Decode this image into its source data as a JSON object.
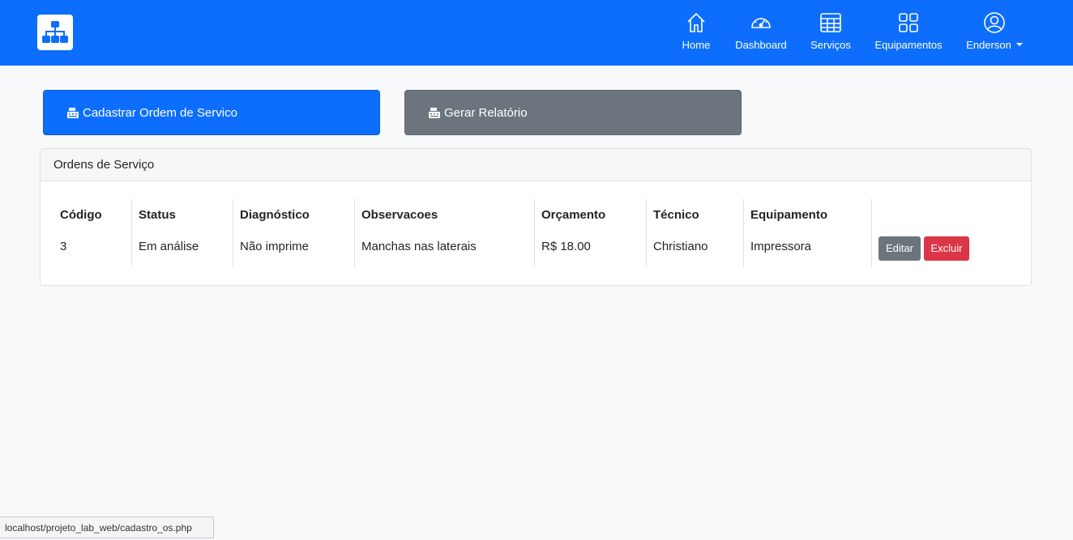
{
  "navbar": {
    "brand_icon": "sitemap-icon",
    "items": [
      {
        "label": "Home",
        "icon": "house-icon"
      },
      {
        "label": "Dashboard",
        "icon": "speedometer-icon"
      },
      {
        "label": "Serviços",
        "icon": "table-icon"
      },
      {
        "label": "Equipamentos",
        "icon": "grid-icon"
      },
      {
        "label": "Enderson",
        "icon": "person-circle-icon"
      }
    ],
    "color": "#0d6efd"
  },
  "actions": {
    "register_label": "Cadastrar Ordem de Servico",
    "report_label": "Gerar Relatório"
  },
  "card": {
    "title": "Ordens de Serviço",
    "columns": [
      "Código",
      "Status",
      "Diagnóstico",
      "Observacoes",
      "Orçamento",
      "Técnico",
      "Equipamento"
    ],
    "rows": [
      {
        "cells": [
          "3",
          "Em análise",
          "Não imprime",
          "Manchas nas laterais",
          "R$ 18.00",
          "Christiano",
          "Impressora"
        ],
        "edit_label": "Editar",
        "delete_label": "Excluir"
      }
    ]
  },
  "statusbar": {
    "url": "localhost/projeto_lab_web/cadastro_os.php"
  },
  "colors": {
    "primary": "#0d6efd",
    "secondary": "#6c757d",
    "danger": "#dc3545"
  }
}
